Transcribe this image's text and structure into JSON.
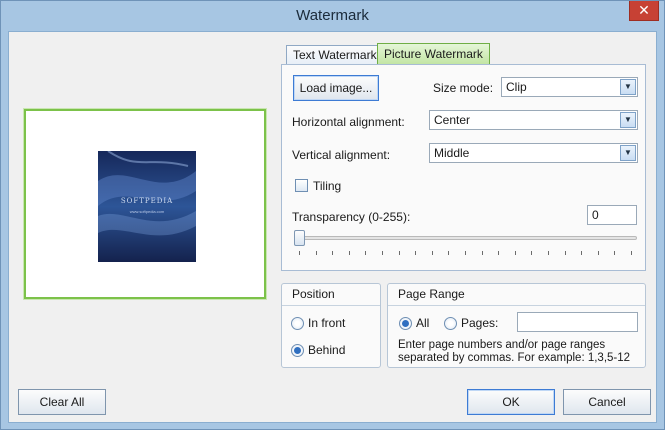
{
  "window": {
    "title": "Watermark",
    "close_glyph": "✕"
  },
  "preview": {
    "watermark_text": "SOFTPEDIA",
    "watermark_subtext": "www.softpedia.com",
    "background_color": "#213e72"
  },
  "tabs": [
    {
      "label": "Text Watermark",
      "active": false
    },
    {
      "label": "Picture Watermark",
      "active": true
    }
  ],
  "picture_tab": {
    "load_image_label": "Load image...",
    "size_mode_label": "Size mode:",
    "size_mode_value": "Clip",
    "horizontal_alignment_label": "Horizontal alignment:",
    "horizontal_alignment_value": "Center",
    "vertical_alignment_label": "Vertical alignment:",
    "vertical_alignment_value": "Middle",
    "tiling_label": "Tiling",
    "tiling_checked": false,
    "transparency_label": "Transparency (0-255):",
    "transparency_value": "0",
    "transparency_level": 0
  },
  "position": {
    "title": "Position",
    "options": [
      {
        "label": "In front",
        "checked": false
      },
      {
        "label": "Behind",
        "checked": true
      }
    ]
  },
  "page_range": {
    "title": "Page Range",
    "all_label": "All",
    "all_checked": true,
    "pages_label": "Pages:",
    "pages_checked": false,
    "pages_value": "",
    "note_line1": "Enter page numbers and/or page ranges",
    "note_line2": "separated by commas. For example: 1,3,5-12"
  },
  "buttons": {
    "clear_all": "Clear All",
    "ok": "OK",
    "cancel": "Cancel"
  },
  "colors": {
    "accent_green": "#7cc24a",
    "accent_blue": "#2f6fc0",
    "close_red": "#c74134"
  }
}
